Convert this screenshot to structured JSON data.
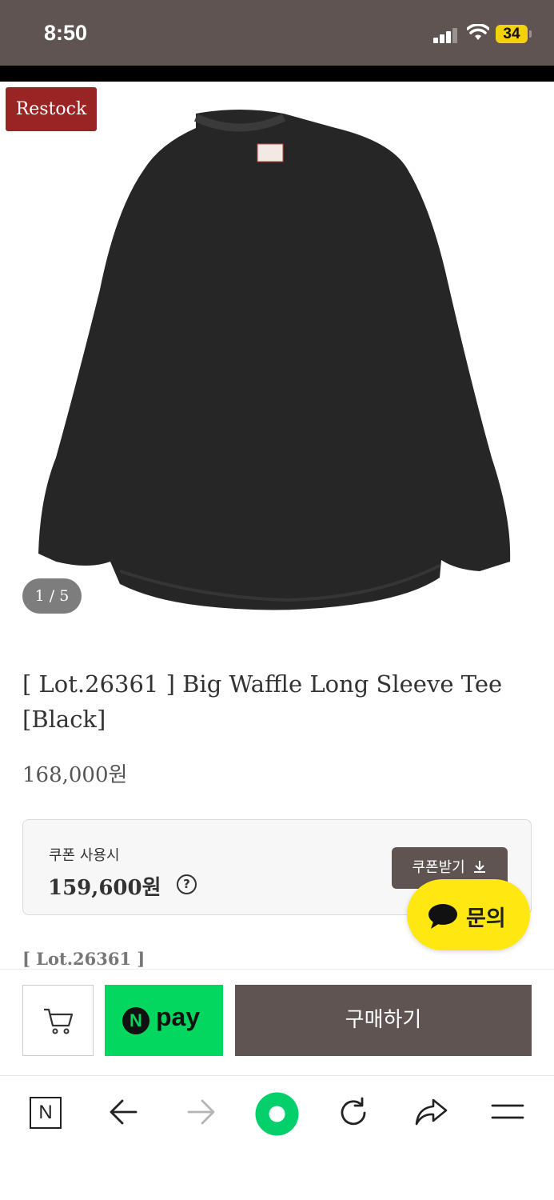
{
  "status_bar": {
    "time": "8:50",
    "battery": "34"
  },
  "product": {
    "badge": "Restock",
    "image_counter": "1 / 5",
    "title": "[ Lot.26361 ] Big Waffle Long Sleeve Tee [Black]",
    "price": "168,000원"
  },
  "coupon": {
    "label": "쿠폰 사용시",
    "price": "159,600원",
    "help_icon": "?",
    "get_label": "쿠폰받기"
  },
  "inquiry": {
    "label": "문의"
  },
  "lot_peek": "[ Lot.26361 ]",
  "action_bar": {
    "npay_n": "N",
    "npay_label": "pay",
    "buy_label": "구매하기"
  },
  "browser_bar": {
    "home_letter": "N",
    "icons": [
      "naver-home-icon",
      "back-arrow-icon",
      "forward-arrow-icon",
      "green-dot-icon",
      "reload-icon",
      "share-icon",
      "menu-icon"
    ]
  },
  "colors": {
    "status_bar": "#5f5452",
    "badge": "#9a2323",
    "primary_button": "#5f5452",
    "npay_green": "#03d75f",
    "inquiry_yellow": "#ffe812"
  }
}
